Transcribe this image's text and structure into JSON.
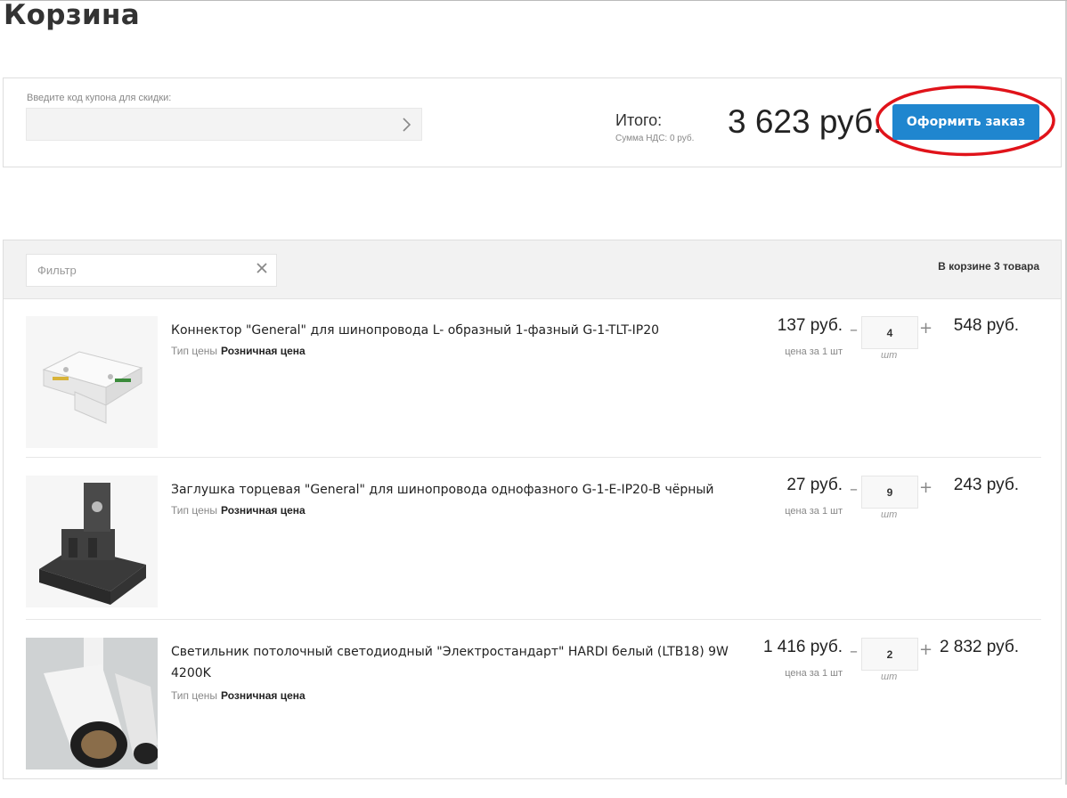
{
  "page": {
    "title": "Корзина"
  },
  "coupon": {
    "label": "Введите код купона для скидки:",
    "value": ""
  },
  "summary": {
    "total_label": "Итого:",
    "vat_label": "Сумма НДС: 0 руб.",
    "total_value": "3 623 руб.",
    "checkout_label": "Оформить заказ"
  },
  "basket": {
    "filter_placeholder": "Фильтр",
    "count_text": "В корзине 3 товара",
    "items": [
      {
        "name": "Коннектор \"General\" для шинопровода L- образный 1-фазный G-1-TLT-IP20",
        "price_type_label": "Тип цены",
        "price_type_value": "Розничная цена",
        "unit_price": "137 руб.",
        "unit_label": "цена за 1 шт",
        "quantity": "4",
        "qty_unit": "шт",
        "sum": "548 руб."
      },
      {
        "name": "Заглушка торцевая \"General\" для шинопровода однофазного G-1-E-IP20-B чёрный",
        "price_type_label": "Тип цены",
        "price_type_value": "Розничная цена",
        "unit_price": "27 руб.",
        "unit_label": "цена за 1 шт",
        "quantity": "9",
        "qty_unit": "шт",
        "sum": "243 руб."
      },
      {
        "name": "Светильник потолочный светодиодный \"Электростандарт\" HARDI белый (LTB18) 9W 4200K",
        "price_type_label": "Тип цены",
        "price_type_value": "Розничная цена",
        "unit_price": "1 416 руб.",
        "unit_label": "цена за 1 шт",
        "quantity": "2",
        "qty_unit": "шт",
        "sum": "2 832 руб."
      }
    ]
  },
  "colors": {
    "accent": "#1f86cf",
    "highlight": "#e0131a"
  }
}
